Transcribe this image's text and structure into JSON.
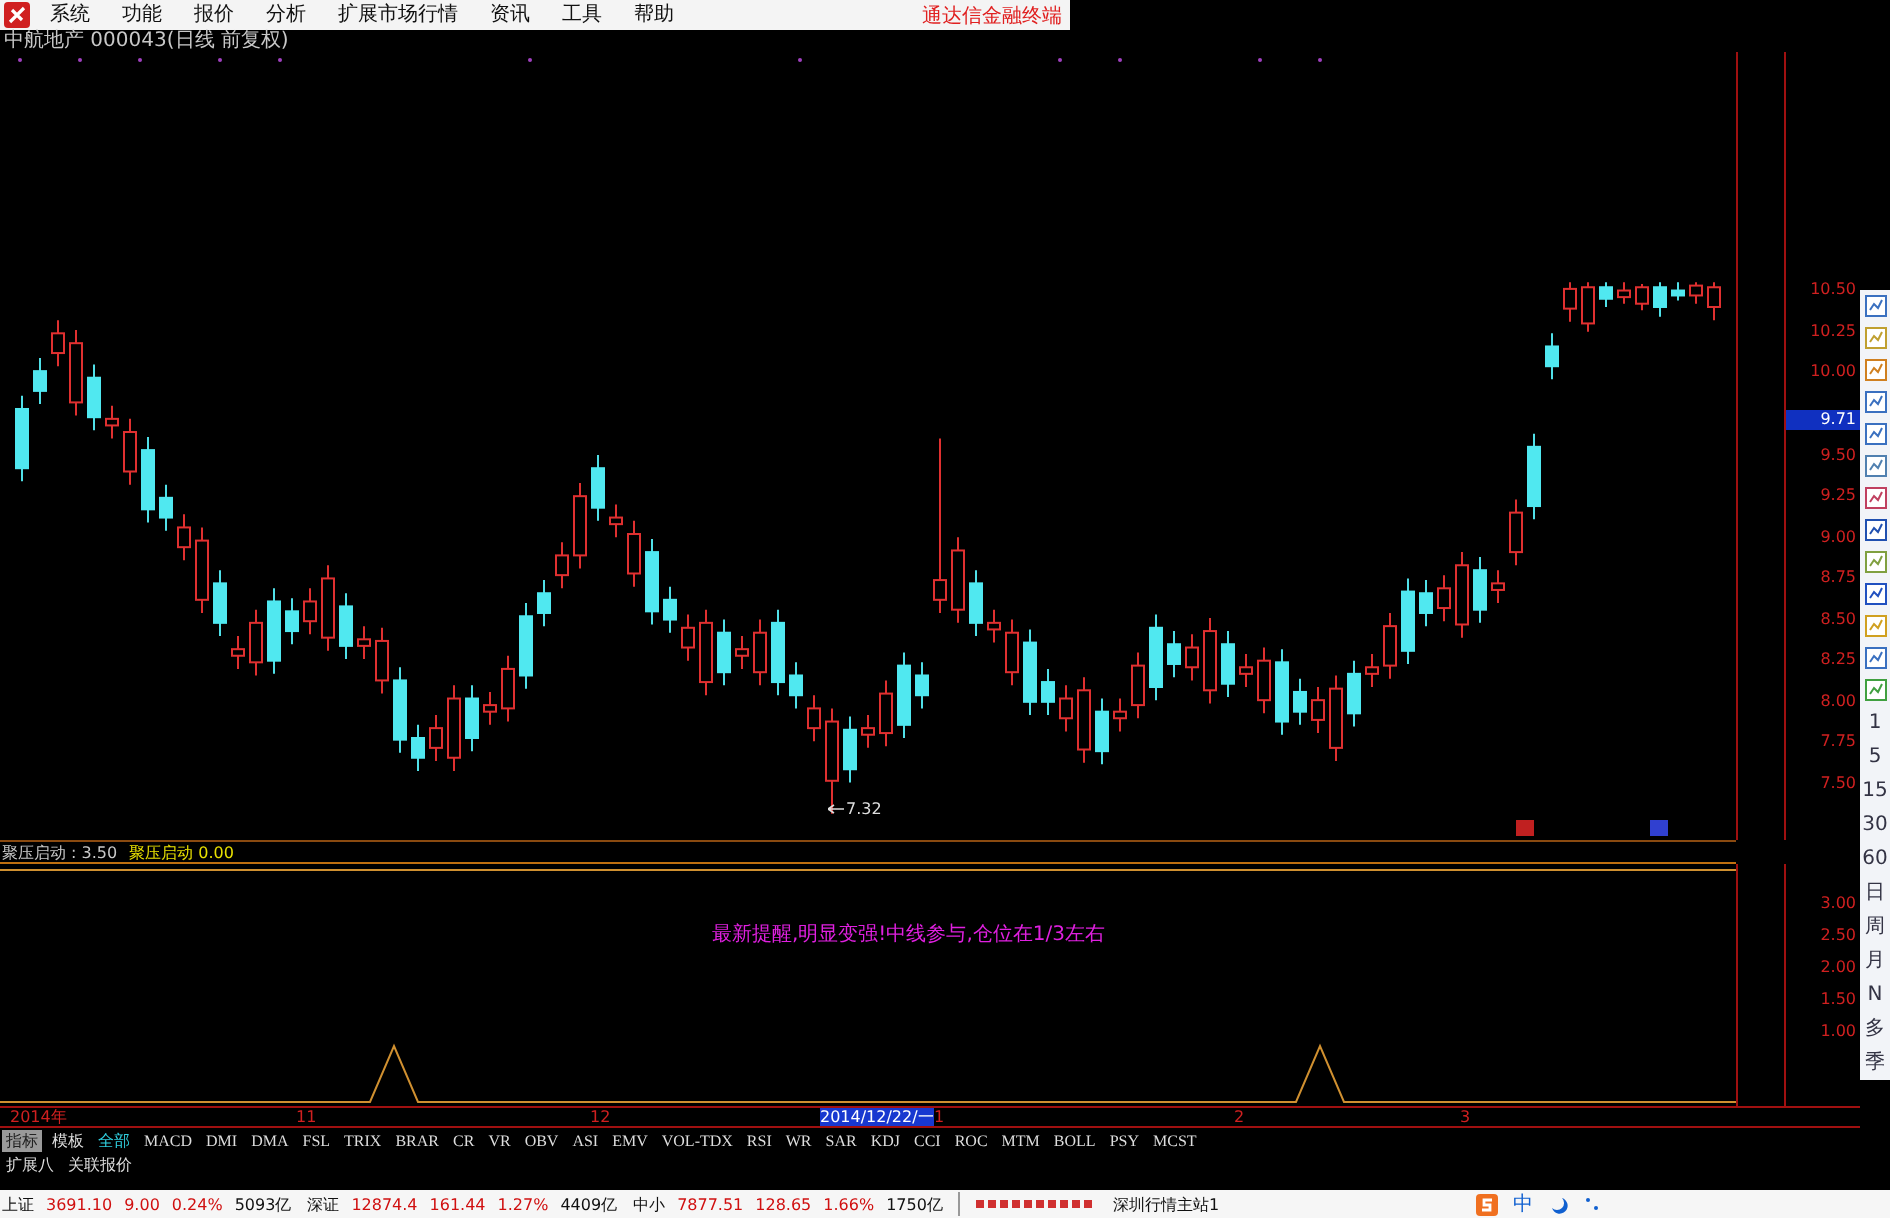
{
  "menu_bar": {
    "items": [
      "系统",
      "功能",
      "报价",
      "分析",
      "扩展市场行情",
      "资讯",
      "工具",
      "帮助"
    ],
    "brand": "通达信金融终端"
  },
  "chart_title": "中航地产 000043(日线 前复权)",
  "price_chart": {
    "current_price": "9.71",
    "chart_data": {
      "type": "candlestick",
      "categories": [
        null,
        null,
        null,
        null,
        null,
        null,
        null,
        null,
        null,
        null,
        null,
        null,
        null,
        null,
        null,
        null,
        null,
        null,
        null,
        null,
        null,
        null,
        null,
        null,
        null,
        null,
        null,
        null,
        null,
        null,
        null,
        null,
        null,
        null,
        null,
        null,
        null,
        null,
        null,
        null,
        null,
        null,
        null,
        null,
        null,
        null,
        null,
        null,
        null,
        null,
        null,
        null,
        null,
        null,
        null,
        null,
        null,
        null,
        null,
        null,
        null,
        null,
        null,
        null,
        null,
        null,
        null,
        null,
        null,
        null,
        null,
        null,
        null,
        null,
        null,
        null,
        null,
        null,
        null,
        null,
        null,
        null,
        null,
        null,
        null,
        null,
        null,
        null,
        null,
        null,
        null,
        null,
        null,
        null,
        null
      ],
      "ylim": [
        7.16,
        11.95
      ],
      "yticks": [
        {
          "value": 10.5,
          "label": "10.50"
        },
        {
          "value": 10.25,
          "label": "10.25"
        },
        {
          "value": 10.0,
          "label": "10.00"
        },
        {
          "value": 9.5,
          "label": "9.50"
        },
        {
          "value": 9.25,
          "label": "9.25"
        },
        {
          "value": 9.0,
          "label": "9.00"
        },
        {
          "value": 8.75,
          "label": "8.75"
        },
        {
          "value": 8.5,
          "label": "8.50"
        },
        {
          "value": 8.25,
          "label": "8.25"
        },
        {
          "value": 8.0,
          "label": "8.00"
        },
        {
          "value": 7.75,
          "label": "7.75"
        },
        {
          "value": 7.5,
          "label": "7.50"
        }
      ],
      "ohlc": [
        [
          9.78,
          9.86,
          9.34,
          9.42
        ],
        [
          10.01,
          10.09,
          9.81,
          9.89
        ],
        [
          10.12,
          10.32,
          10.04,
          10.24
        ],
        [
          9.82,
          10.26,
          9.74,
          10.18
        ],
        [
          9.97,
          10.05,
          9.65,
          9.73
        ],
        [
          9.68,
          9.8,
          9.6,
          9.72
        ],
        [
          9.4,
          9.72,
          9.32,
          9.64
        ],
        [
          9.53,
          9.61,
          9.09,
          9.17
        ],
        [
          9.24,
          9.32,
          9.04,
          9.12
        ],
        [
          8.94,
          9.14,
          8.86,
          9.06
        ],
        [
          8.62,
          9.06,
          8.54,
          8.98
        ],
        [
          8.72,
          8.8,
          8.4,
          8.48
        ],
        [
          8.28,
          8.4,
          8.2,
          8.32
        ],
        [
          8.24,
          8.56,
          8.16,
          8.48
        ],
        [
          8.61,
          8.69,
          8.17,
          8.25
        ],
        [
          8.55,
          8.63,
          8.35,
          8.43
        ],
        [
          8.49,
          8.69,
          8.41,
          8.61
        ],
        [
          8.39,
          8.83,
          8.31,
          8.75
        ],
        [
          8.58,
          8.66,
          8.26,
          8.34
        ],
        [
          8.34,
          8.46,
          8.26,
          8.38
        ],
        [
          8.13,
          8.45,
          8.05,
          8.37
        ],
        [
          8.13,
          8.21,
          7.69,
          7.77
        ],
        [
          7.78,
          7.86,
          7.58,
          7.66
        ],
        [
          7.72,
          7.92,
          7.64,
          7.84
        ],
        [
          7.66,
          8.1,
          7.58,
          8.02
        ],
        [
          8.02,
          8.1,
          7.7,
          7.78
        ],
        [
          7.94,
          8.06,
          7.86,
          7.98
        ],
        [
          7.96,
          8.28,
          7.88,
          8.2
        ],
        [
          8.52,
          8.6,
          8.08,
          8.16
        ],
        [
          8.66,
          8.74,
          8.46,
          8.54
        ],
        [
          8.77,
          8.97,
          8.69,
          8.89
        ],
        [
          8.89,
          9.33,
          8.81,
          9.25
        ],
        [
          9.42,
          9.5,
          9.1,
          9.18
        ],
        [
          9.08,
          9.2,
          9.0,
          9.12
        ],
        [
          8.78,
          9.1,
          8.7,
          9.02
        ],
        [
          8.91,
          8.99,
          8.47,
          8.55
        ],
        [
          8.62,
          8.7,
          8.42,
          8.5
        ],
        [
          8.33,
          8.53,
          8.25,
          8.45
        ],
        [
          8.12,
          8.56,
          8.04,
          8.48
        ],
        [
          8.42,
          8.5,
          8.1,
          8.18
        ],
        [
          8.28,
          8.4,
          8.2,
          8.32
        ],
        [
          8.18,
          8.5,
          8.1,
          8.42
        ],
        [
          8.48,
          8.56,
          8.04,
          8.12
        ],
        [
          8.16,
          8.24,
          7.96,
          8.04
        ],
        [
          7.84,
          8.04,
          7.76,
          7.96
        ],
        [
          7.52,
          7.96,
          7.32,
          7.88
        ],
        [
          7.83,
          7.91,
          7.51,
          7.59
        ],
        [
          7.8,
          7.92,
          7.72,
          7.84
        ],
        [
          7.81,
          8.13,
          7.73,
          8.05
        ],
        [
          8.22,
          8.3,
          7.78,
          7.86
        ],
        [
          8.16,
          8.24,
          7.96,
          8.04
        ],
        [
          8.62,
          9.6,
          8.54,
          8.74
        ],
        [
          8.56,
          9.0,
          8.48,
          8.92
        ],
        [
          8.72,
          8.8,
          8.4,
          8.48
        ],
        [
          8.44,
          8.56,
          8.36,
          8.48
        ],
        [
          8.18,
          8.5,
          8.1,
          8.42
        ],
        [
          8.36,
          8.44,
          7.92,
          8.0
        ],
        [
          8.12,
          8.2,
          7.92,
          8.0
        ],
        [
          7.9,
          8.1,
          7.82,
          8.02
        ],
        [
          7.71,
          8.15,
          7.63,
          8.07
        ],
        [
          7.94,
          8.02,
          7.62,
          7.7
        ],
        [
          7.9,
          8.02,
          7.82,
          7.94
        ],
        [
          7.98,
          8.3,
          7.9,
          8.22
        ],
        [
          8.45,
          8.53,
          8.01,
          8.09
        ],
        [
          8.35,
          8.43,
          8.15,
          8.23
        ],
        [
          8.21,
          8.41,
          8.13,
          8.33
        ],
        [
          8.07,
          8.51,
          7.99,
          8.43
        ],
        [
          8.35,
          8.43,
          8.03,
          8.11
        ],
        [
          8.17,
          8.29,
          8.09,
          8.21
        ],
        [
          8.01,
          8.33,
          7.93,
          8.25
        ],
        [
          8.24,
          8.32,
          7.8,
          7.88
        ],
        [
          8.06,
          8.14,
          7.86,
          7.94
        ],
        [
          7.89,
          8.09,
          7.81,
          8.01
        ],
        [
          7.72,
          8.16,
          7.64,
          8.08
        ],
        [
          8.17,
          8.25,
          7.85,
          7.93
        ],
        [
          8.17,
          8.29,
          8.09,
          8.21
        ],
        [
          8.22,
          8.54,
          8.14,
          8.46
        ],
        [
          8.67,
          8.75,
          8.23,
          8.31
        ],
        [
          8.66,
          8.74,
          8.46,
          8.54
        ],
        [
          8.57,
          8.77,
          8.49,
          8.69
        ],
        [
          8.47,
          8.91,
          8.39,
          8.83
        ],
        [
          8.8,
          8.88,
          8.48,
          8.56
        ],
        [
          8.68,
          8.8,
          8.6,
          8.72
        ],
        [
          8.91,
          9.23,
          8.83,
          9.15
        ],
        [
          9.55,
          9.63,
          9.11,
          9.19
        ],
        [
          10.16,
          10.24,
          9.96,
          10.04
        ],
        [
          10.39,
          10.55,
          10.31,
          10.51
        ],
        [
          10.3,
          10.55,
          10.25,
          10.52
        ],
        [
          10.52,
          10.55,
          10.4,
          10.45
        ],
        [
          10.46,
          10.55,
          10.42,
          10.5
        ],
        [
          10.42,
          10.54,
          10.38,
          10.52
        ],
        [
          10.52,
          10.55,
          10.34,
          10.4
        ],
        [
          10.5,
          10.55,
          10.44,
          10.47
        ],
        [
          10.47,
          10.55,
          10.42,
          10.53
        ],
        [
          10.4,
          10.55,
          10.32,
          10.52
        ]
      ]
    }
  },
  "low_marker": "7.32",
  "indicator": {
    "readings": [
      {
        "label": "聚压启动 :",
        "value": "3.50",
        "color": "#c8c8c8"
      },
      {
        "label": "聚压启动",
        "value": "0.00",
        "color": "#e8e000"
      }
    ],
    "message": "最新提醒,明显变强!中线参与,仓位在1/3左右",
    "axis": [
      "3.00",
      "2.50",
      "2.00",
      "1.50",
      "1.00"
    ]
  },
  "date_axis": [
    {
      "text": "2014年",
      "kind": "tick"
    },
    {
      "text": "11",
      "kind": "tick"
    },
    {
      "text": "12",
      "kind": "tick"
    },
    {
      "text": "2014/12/22/一",
      "kind": "cursor"
    },
    {
      "text": "1",
      "kind": "tick"
    },
    {
      "text": "2",
      "kind": "tick"
    },
    {
      "text": "3",
      "kind": "tick"
    }
  ],
  "mode_tabs": [
    {
      "label": "指标",
      "selected": true
    },
    {
      "label": "模板",
      "selected": false
    }
  ],
  "formula_tabs": [
    {
      "label": "全部",
      "selected": true
    },
    {
      "label": "MACD",
      "selected": false
    },
    {
      "label": "DMI",
      "selected": false
    },
    {
      "label": "DMA",
      "selected": false
    },
    {
      "label": "FSL",
      "selected": false
    },
    {
      "label": "TRIX",
      "selected": false
    },
    {
      "label": "BRAR",
      "selected": false
    },
    {
      "label": "CR",
      "selected": false
    },
    {
      "label": "VR",
      "selected": false
    },
    {
      "label": "OBV",
      "selected": false
    },
    {
      "label": "ASI",
      "selected": false
    },
    {
      "label": "EMV",
      "selected": false
    },
    {
      "label": "VOL-TDX",
      "selected": false
    },
    {
      "label": "RSI",
      "selected": false
    },
    {
      "label": "WR",
      "selected": false
    },
    {
      "label": "SAR",
      "selected": false
    },
    {
      "label": "KDJ",
      "selected": false
    },
    {
      "label": "CCI",
      "selected": false
    },
    {
      "label": "ROC",
      "selected": false
    },
    {
      "label": "MTM",
      "selected": false
    },
    {
      "label": "BOLL",
      "selected": false
    },
    {
      "label": "PSY",
      "selected": false
    },
    {
      "label": "MCST",
      "selected": false
    }
  ],
  "extension_tabs": [
    "扩展八",
    "关联报价"
  ],
  "periods": [
    "1",
    "5",
    "15",
    "30",
    "60",
    "日",
    "周",
    "月",
    "N",
    "多",
    "季"
  ],
  "status_bar": {
    "indices": [
      {
        "name": "上证",
        "value": "3691.10",
        "change": "9.00",
        "percent": "0.24%",
        "volume": "5093亿"
      },
      {
        "name": "深证",
        "value": "12874.4",
        "change": "161.44",
        "percent": "1.27%",
        "volume": "4409亿"
      },
      {
        "name": "中小",
        "value": "7877.51",
        "change": "128.65",
        "percent": "1.66%",
        "volume": "1750亿"
      }
    ],
    "server": "深圳行情主站1",
    "ime": "中"
  }
}
